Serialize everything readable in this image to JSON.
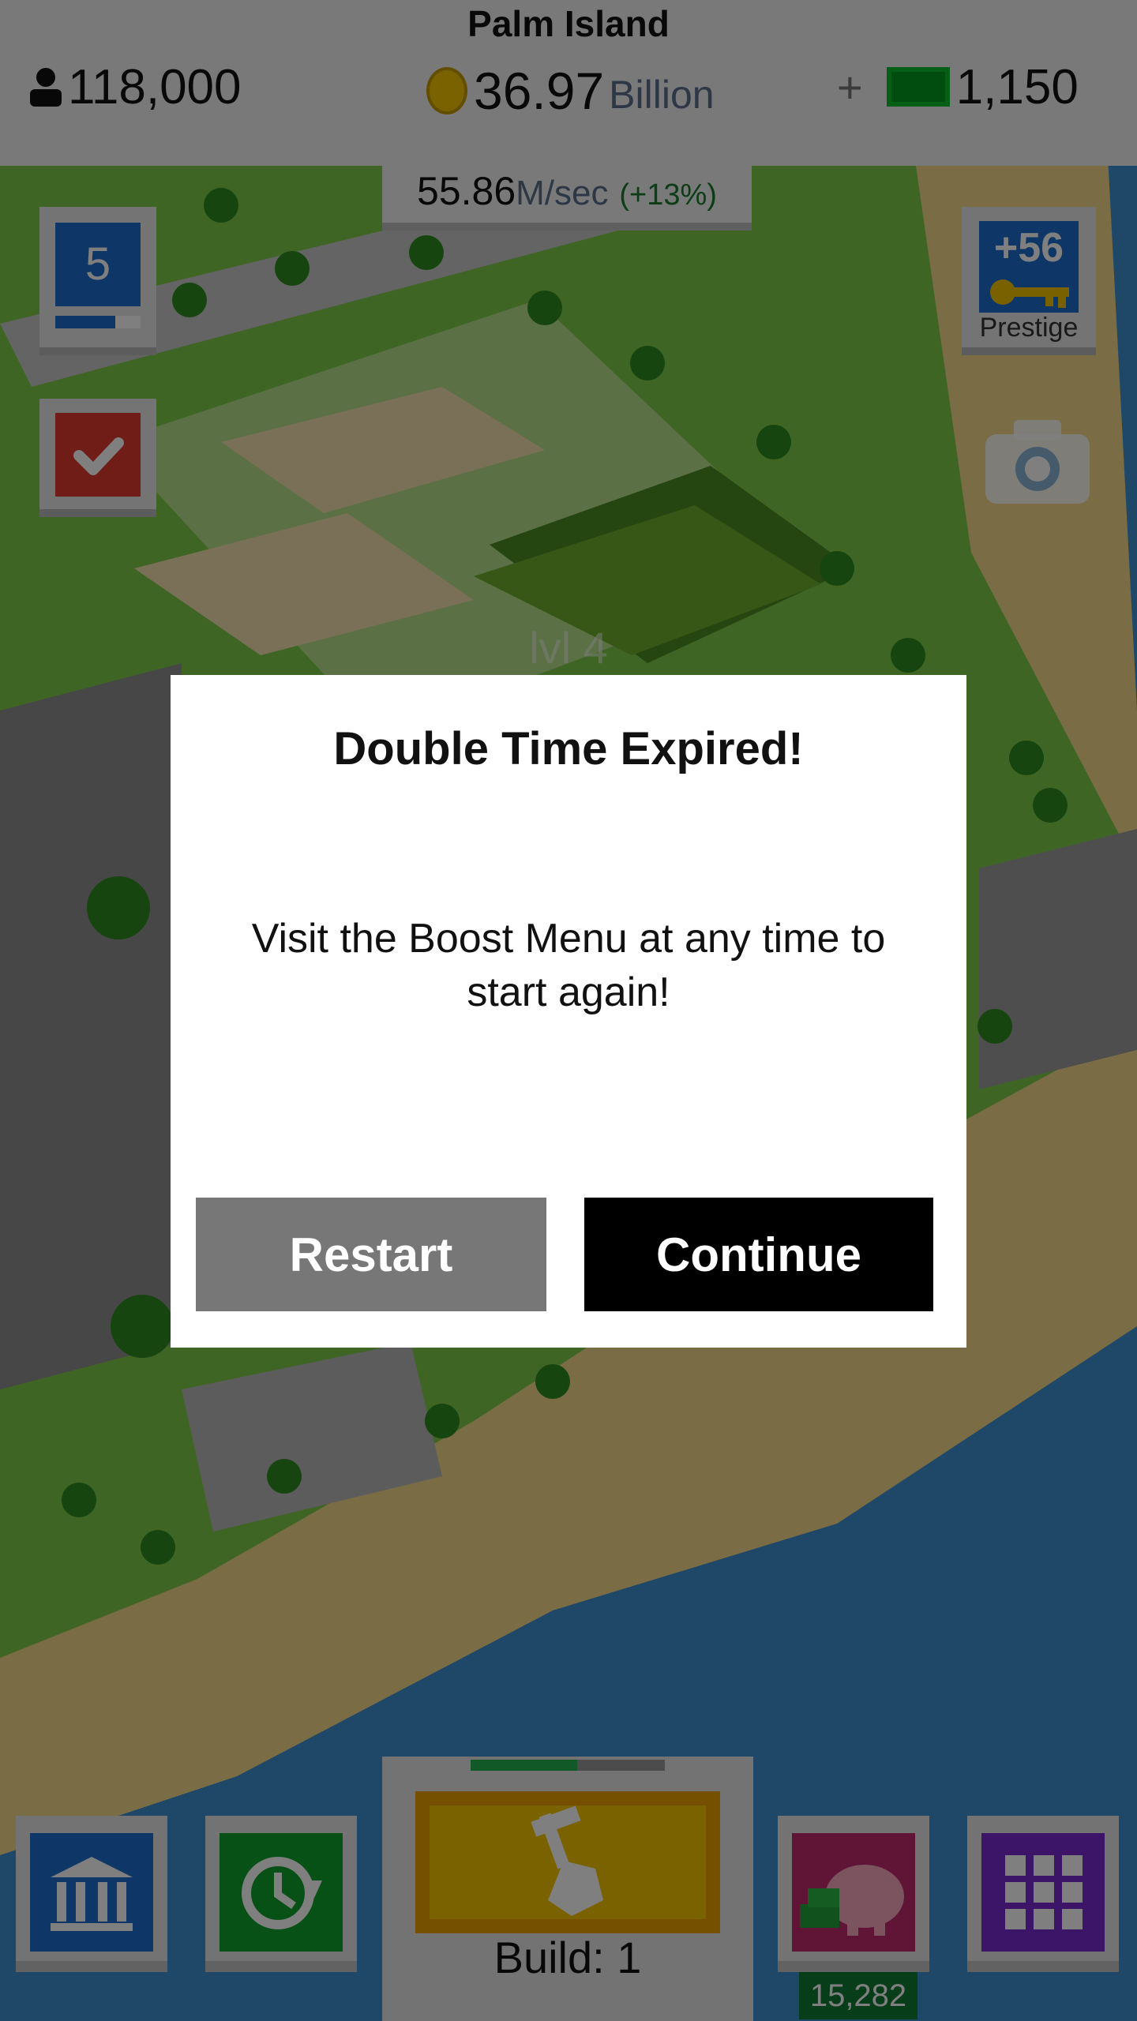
{
  "hud": {
    "city_name": "Palm Island",
    "population": "118,000",
    "coins_amount": "36.97",
    "coins_unit": "Billion",
    "cash_plus": "+",
    "cash_amount": "1,150",
    "rate_value": "55.86",
    "rate_unit": "M/sec",
    "rate_bonus": "(+13%)"
  },
  "side": {
    "level_value": "5",
    "level_progress": 0.7,
    "prestige_value": "+56",
    "prestige_label": "Prestige"
  },
  "map": {
    "plot_label": "lvl 4"
  },
  "dialog": {
    "title": "Double Time Expired!",
    "message": "Visit the Boost Menu at any time to start again!",
    "restart_label": "Restart",
    "continue_label": "Continue"
  },
  "bottom": {
    "build_label": "Build: 1",
    "build_progress": 0.55,
    "piggy_count": "15,282"
  },
  "icons": [
    "person-icon",
    "coin-icon",
    "cash-icon",
    "check-icon",
    "key-icon",
    "camera-icon",
    "bank-icon",
    "clock-icon",
    "hammer-icon",
    "piggy-bank-icon",
    "grid-icon"
  ],
  "colors": {
    "dialog_bg": "#ffffff",
    "restart_bg": "#777777",
    "continue_bg": "#000000",
    "dim_overlay": "rgba(0,0,0,0.5)"
  }
}
